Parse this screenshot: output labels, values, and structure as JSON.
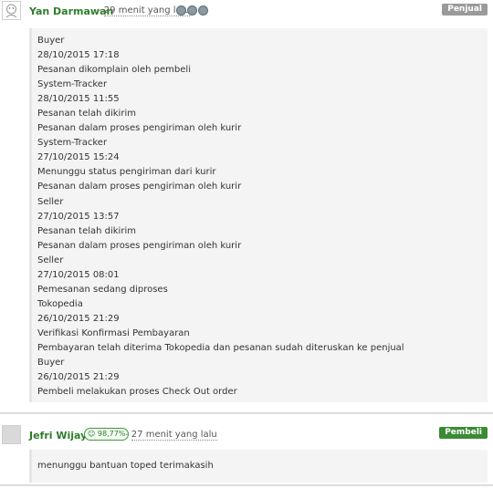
{
  "comments": [
    {
      "name": "Yan Darmawan",
      "time": "29 menit yang lalu",
      "role": "Penjual",
      "lines": [
        "Buyer",
        "28/10/2015 17:18",
        "Pesanan dikomplain oleh pembeli",
        "System-Tracker",
        "28/10/2015 11:55",
        "Pesanan telah dikirim",
        "Pesanan dalam proses pengiriman oleh kurir",
        "System-Tracker",
        "27/10/2015 15:24",
        "Menunggu status pengiriman dari kurir",
        "Pesanan dalam proses pengiriman oleh kurir",
        "Seller",
        "27/10/2015 13:57",
        "Pesanan telah dikirim",
        "Pesanan dalam proses pengiriman oleh kurir",
        "Seller",
        "27/10/2015 08:01",
        "Pemesanan sedang diproses",
        "Tokopedia",
        "26/10/2015 21:29",
        "Verifikasi Konfirmasi Pembayaran",
        "Pembayaran telah diterima Tokopedia dan pesanan sudah diteruskan ke penjual",
        "Buyer",
        "26/10/2015 21:29",
        "Pembeli melakukan proses Check Out order"
      ]
    },
    {
      "name": "Jefri Wijaya",
      "score": "98,77%",
      "time": "27 menit yang lalu",
      "role": "Pembeli",
      "lines": [
        "menunggu bantuan toped terimakasih"
      ]
    }
  ],
  "separator": "-",
  "icons": {
    "avatar": "avatar-icon",
    "medal": "medal-icon",
    "reputation": "smiley-icon"
  },
  "colors": {
    "name": "#2e7d2a",
    "seller_badge": "#9a9a9a",
    "buyer_badge": "#3a8b34"
  }
}
